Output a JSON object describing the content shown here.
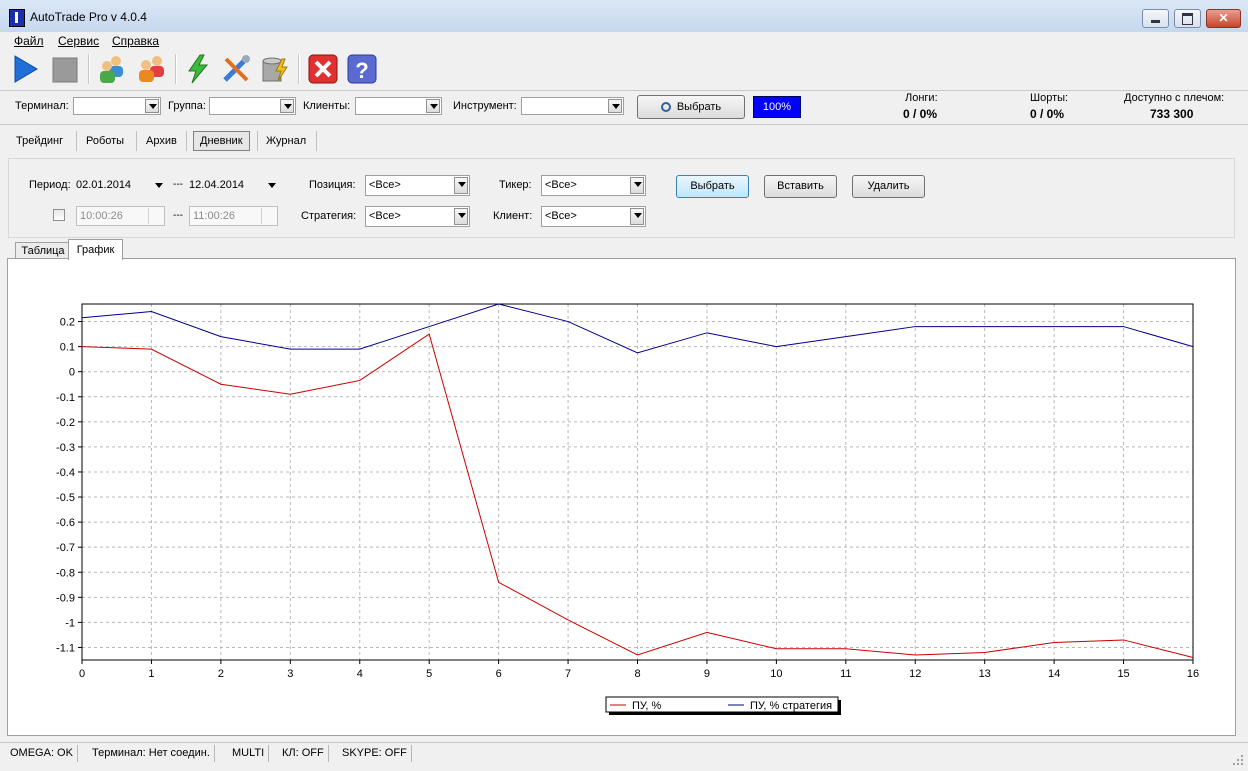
{
  "window": {
    "title": "AutoTrade Pro v 4.0.4"
  },
  "menu": [
    "Файл",
    "Сервис",
    "Справка"
  ],
  "toolbar": {
    "icons": [
      "play-icon",
      "stop-icon",
      "users-icon",
      "users-group-icon",
      "lightning-icon",
      "tools-icon",
      "database-icon",
      "close-red-icon",
      "help-icon"
    ]
  },
  "filters": {
    "terminal_label": "Терминал:",
    "group_label": "Группа:",
    "clients_label": "Клиенты:",
    "instrument_label": "Инструмент:",
    "select_button": "Выбрать",
    "progress_text": "100%",
    "progress_color": "#0000ff"
  },
  "stats": {
    "longs_label": "Лонги:",
    "longs_value": "0 / 0%",
    "shorts_label": "Шорты:",
    "shorts_value": "0 / 0%",
    "available_label": "Доступно с плечом:",
    "available_value": "733 300"
  },
  "tabs": [
    "Трейдинг",
    "Роботы",
    "Архив",
    "Дневник",
    "Журнал"
  ],
  "active_tab": "Дневник",
  "diary": {
    "period_label": "Период:",
    "date_from": "02.01.2014",
    "date_sep": "---",
    "date_to": "12.04.2014",
    "time_from": "10:00:26",
    "time_to": "11:00:26",
    "position_label": "Позиция:",
    "position_value": "<Все>",
    "strategy_label": "Стратегия:",
    "strategy_value": "<Все>",
    "ticker_label": "Тикер:",
    "ticker_value": "<Все>",
    "client_label": "Клиент:",
    "client_value": "<Все>",
    "btn_select": "Выбрать",
    "btn_insert": "Вставить",
    "btn_delete": "Удалить"
  },
  "subtabs": [
    "Таблица",
    "График"
  ],
  "active_subtab": "График",
  "chart_data": {
    "type": "line",
    "x": [
      0,
      1,
      2,
      3,
      4,
      5,
      6,
      7,
      8,
      9,
      10,
      11,
      12,
      13,
      14,
      15,
      16
    ],
    "series": [
      {
        "name": "ПУ, %",
        "color": "#cc0000",
        "values": [
          0.1,
          0.09,
          -0.05,
          -0.09,
          -0.035,
          0.15,
          -0.84,
          -0.99,
          -1.13,
          -1.04,
          -1.105,
          -1.105,
          -1.13,
          -1.12,
          -1.08,
          -1.07,
          -1.14
        ]
      },
      {
        "name": "ПУ, % стратегия",
        "color": "#00008b",
        "values": [
          0.215,
          0.24,
          0.14,
          0.09,
          0.09,
          0.18,
          0.27,
          0.2,
          0.075,
          0.155,
          0.1,
          0.14,
          0.18,
          0.18,
          0.18,
          0.18,
          0.1
        ]
      }
    ],
    "xlim": [
      0,
      16
    ],
    "ylim": [
      -1.15,
      0.27
    ],
    "yticks": [
      0.2,
      0.1,
      0,
      -0.1,
      -0.2,
      -0.3,
      -0.4,
      -0.5,
      -0.6,
      -0.7,
      -0.8,
      -0.9,
      -1,
      -1.1
    ],
    "ytick_labels": [
      "0.2",
      "0.1",
      "0",
      "-0.1",
      "-0.2",
      "-0.3",
      "-0.4",
      "-0.5",
      "-0.6",
      "-0.7",
      "-0.8",
      "-0.9",
      "-1",
      "-1.1"
    ],
    "xtick_labels": [
      "0",
      "1",
      "2",
      "3",
      "4",
      "5",
      "6",
      "7",
      "8",
      "9",
      "10",
      "11",
      "12",
      "13",
      "14",
      "15",
      "16"
    ],
    "grid": true,
    "legend": "bottom-center"
  },
  "status": [
    "OMEGA: OK",
    "Терминал: Нет соедин.",
    "MULTI",
    "КЛ: OFF",
    "SKYPE: OFF"
  ]
}
